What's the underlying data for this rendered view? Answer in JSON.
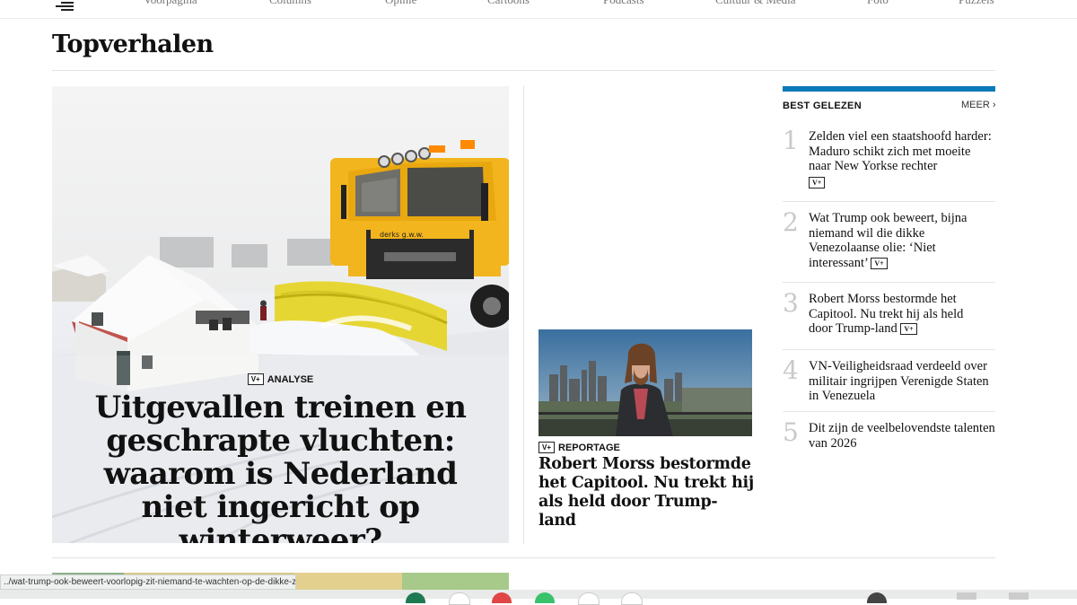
{
  "nav": {
    "items": [
      "Voorpagina",
      "Columns",
      "Opinie",
      "Cartoons",
      "Podcasts",
      "Cultuur & Media",
      "Foto",
      "Puzzels"
    ]
  },
  "section": {
    "title": "Topverhalen"
  },
  "lead": {
    "badge": "V+",
    "kicker": "ANALYSE",
    "headline": "Uitgevallen treinen en geschrapte vluchten: waarom is Nederland niet ingericht op winterweer?",
    "truck_text": "derks g.w.w."
  },
  "story2": {
    "badge": "V+",
    "kicker": "REPORTAGE",
    "headline": "Robert Morss bestormde het Capitool. Nu trekt hij als held door Trump-land"
  },
  "best_gelezen": {
    "title": "BEST GELEZEN",
    "more": "MEER",
    "items": [
      {
        "num": "1",
        "text": "Zelden viel een staatshoofd harder: Maduro schikt zich met moeite naar New Yorkse rechter",
        "badge": "V+"
      },
      {
        "num": "2",
        "text": "Wat Trump ook beweert, bijna niemand wil die dikke Venezolaanse olie: ‘Niet interessant’",
        "badge": "V+"
      },
      {
        "num": "3",
        "text": "Robert Morss bestormde het Capitool. Nu trekt hij als held door Trump-land",
        "badge": "V+"
      },
      {
        "num": "4",
        "text": "VN-Veiligheidsraad verdeeld over militair ingrijpen Verenigde Staten in Venezuela",
        "badge": ""
      },
      {
        "num": "5",
        "text": "Dit zijn de veelbelovendste talenten van 2026",
        "badge": ""
      }
    ]
  },
  "status": {
    "url": "../wat-trump-ook-beweert-voorlopig-zit-niemand-te-wachten-op-de-dikke-zwave..."
  },
  "colors": {
    "accent_blue": "#0a7ab8",
    "truck_yellow": "#f2b51d"
  }
}
